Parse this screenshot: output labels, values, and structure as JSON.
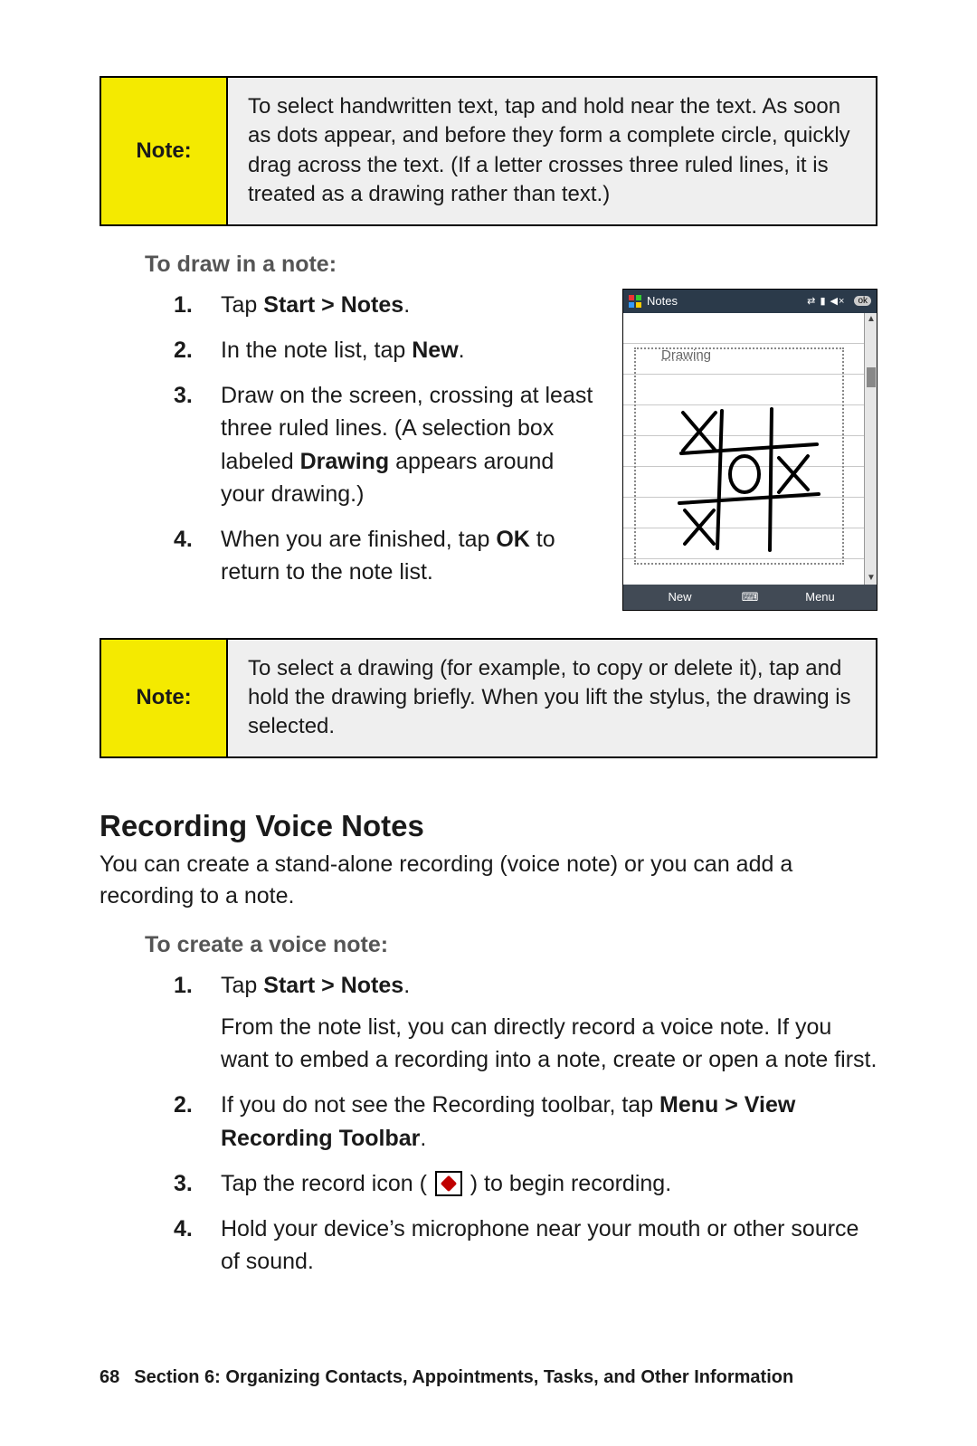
{
  "note1": {
    "label": "Note:",
    "body": "To select handwritten text, tap and hold near the text. As soon as dots appear, and before they form a complete circle, quickly drag across the text. (If a letter crosses three ruled lines, it is treated as a drawing rather than text.)"
  },
  "draw_section": {
    "heading": "To draw in a note:",
    "steps": {
      "s1a": "Tap ",
      "s1b": "Start > Notes",
      "s1c": ".",
      "s2a": "In the note list, tap ",
      "s2b": "New",
      "s2c": ".",
      "s3a": "Draw on the screen, crossing at least three ruled lines. (A selection box labeled ",
      "s3b": "Drawing",
      "s3c": " appears around your drawing.)",
      "s4a": "When you are finished, tap ",
      "s4b": "OK",
      "s4c": " to return to the note list."
    }
  },
  "device": {
    "title": "Notes",
    "drawing_label": "Drawing",
    "bottom_new": "New",
    "bottom_menu": "Menu",
    "ok": "ok"
  },
  "note2": {
    "label": "Note:",
    "body": "To select a drawing (for example, to copy or delete it), tap and hold the drawing briefly. When you lift the stylus, the drawing is selected."
  },
  "voice": {
    "h2": "Recording Voice Notes",
    "intro": "You can create a stand-alone recording (voice note) or you can add a recording to a note.",
    "subhead": "To create a voice note:",
    "s1a": "Tap ",
    "s1b": "Start > Notes",
    "s1c": ".",
    "s1_sub": "From the note list, you can directly record a voice note. If you want to embed a recording into a note, create or open a note first.",
    "s2a": "If you do not see the Recording toolbar, tap ",
    "s2b": "Menu > View Recording Toolbar",
    "s2c": ".",
    "s3a": "Tap the record icon ( ",
    "s3b": " ) to begin recording.",
    "s4": "Hold your device’s microphone near your mouth or other source of sound."
  },
  "footer": {
    "page": "68",
    "section": "Section 6: Organizing Contacts, Appointments, Tasks, and Other Information"
  }
}
